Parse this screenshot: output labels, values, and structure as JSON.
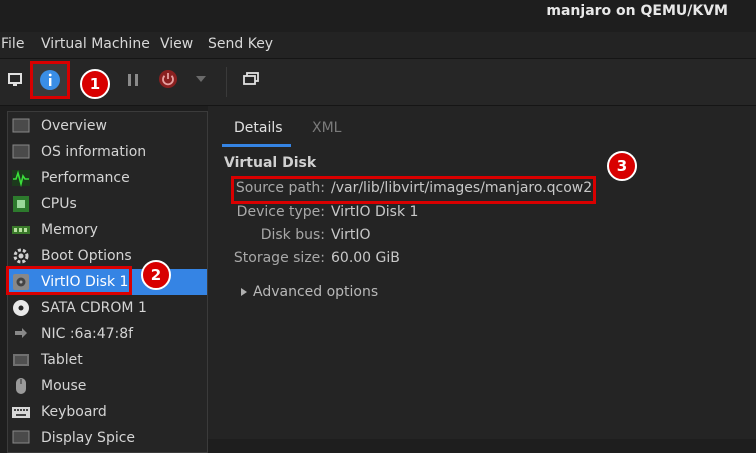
{
  "window": {
    "title": "manjaro on QEMU/KVM"
  },
  "menubar": {
    "items": [
      "File",
      "Virtual Machine",
      "View",
      "Send Key"
    ]
  },
  "toolbar": {
    "buttons": [
      "monitor-icon",
      "info-icon",
      "pause-icon",
      "power-icon",
      "dropdown-icon",
      "fullscreen-icon"
    ]
  },
  "sidebar": {
    "items": [
      {
        "label": "Overview",
        "icon": "overview-icon"
      },
      {
        "label": "OS information",
        "icon": "os-info-icon"
      },
      {
        "label": "Performance",
        "icon": "performance-icon"
      },
      {
        "label": "CPUs",
        "icon": "cpu-icon"
      },
      {
        "label": "Memory",
        "icon": "memory-icon"
      },
      {
        "label": "Boot Options",
        "icon": "gear-icon"
      },
      {
        "label": "VirtIO Disk 1",
        "icon": "disk-icon",
        "selected": true
      },
      {
        "label": "SATA CDROM 1",
        "icon": "cdrom-icon"
      },
      {
        "label": "NIC :6a:47:8f",
        "icon": "network-icon"
      },
      {
        "label": "Tablet",
        "icon": "tablet-icon"
      },
      {
        "label": "Mouse",
        "icon": "mouse-icon"
      },
      {
        "label": "Keyboard",
        "icon": "keyboard-icon"
      },
      {
        "label": "Display Spice",
        "icon": "display-icon"
      }
    ]
  },
  "tabs": [
    {
      "label": "Details",
      "active": true
    },
    {
      "label": "XML",
      "active": false
    }
  ],
  "disk": {
    "heading": "Virtual Disk",
    "fields": [
      {
        "label": "Source path:",
        "value": "/var/lib/libvirt/images/manjaro.qcow2"
      },
      {
        "label": "Device type:",
        "value": "VirtIO Disk 1"
      },
      {
        "label": "Disk bus:",
        "value": "VirtIO"
      },
      {
        "label": "Storage size:",
        "value": "60.00 GiB"
      }
    ],
    "advanced": "Advanced options"
  },
  "annotations": {
    "badges": [
      "1",
      "2",
      "3"
    ],
    "color": "#d80000"
  },
  "colors": {
    "accent": "#3584e4",
    "background": "#1e1e1e"
  }
}
